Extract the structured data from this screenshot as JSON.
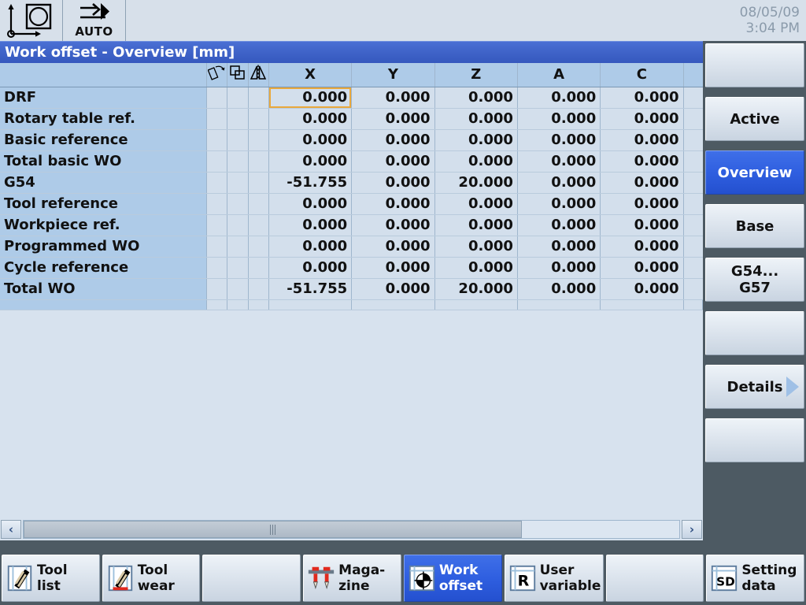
{
  "status_bar": {
    "channel_icon": "coordinate-axes-icon",
    "channel_state_icon": "circle-in-square-icon",
    "mode_icon": "arrow-into-block-icon",
    "mode_label": "AUTO",
    "date": "08/05/09",
    "time": "3:04 PM"
  },
  "window": {
    "title": "Work offset - Overview [mm]"
  },
  "table": {
    "headers": {
      "name": "",
      "rotation_icon": "rotation-icon",
      "scale_icon": "scale-icon",
      "mirror_icon": "mirror-icon",
      "axes": [
        "X",
        "Y",
        "Z",
        "A",
        "C"
      ],
      "tail": ""
    },
    "rows": [
      {
        "name": "DRF",
        "values": [
          "0.000",
          "0.000",
          "0.000",
          "0.000",
          "0.000"
        ]
      },
      {
        "name": "Rotary table ref.",
        "values": [
          "0.000",
          "0.000",
          "0.000",
          "0.000",
          "0.000"
        ]
      },
      {
        "name": "Basic reference",
        "values": [
          "0.000",
          "0.000",
          "0.000",
          "0.000",
          "0.000"
        ]
      },
      {
        "name": "Total basic WO",
        "values": [
          "0.000",
          "0.000",
          "0.000",
          "0.000",
          "0.000"
        ]
      },
      {
        "name": "G54",
        "values": [
          "-51.755",
          "0.000",
          "20.000",
          "0.000",
          "0.000"
        ]
      },
      {
        "name": "Tool reference",
        "values": [
          "0.000",
          "0.000",
          "0.000",
          "0.000",
          "0.000"
        ]
      },
      {
        "name": "Workpiece ref.",
        "values": [
          "0.000",
          "0.000",
          "0.000",
          "0.000",
          "0.000"
        ]
      },
      {
        "name": "Programmed WO",
        "values": [
          "0.000",
          "0.000",
          "0.000",
          "0.000",
          "0.000"
        ]
      },
      {
        "name": "Cycle reference",
        "values": [
          "0.000",
          "0.000",
          "0.000",
          "0.000",
          "0.000"
        ]
      },
      {
        "name": "Total WO",
        "values": [
          "-51.755",
          "0.000",
          "20.000",
          "0.000",
          "0.000"
        ]
      }
    ],
    "selected_cell": {
      "row": 0,
      "col": 0
    }
  },
  "scrollbar": {
    "left_label": "‹",
    "right_label": "›",
    "thumb_percent": 76
  },
  "vertical_softkeys": [
    {
      "label": "",
      "active": false,
      "arrow": false
    },
    {
      "label": "Active",
      "active": false,
      "arrow": false
    },
    {
      "label": "Overview",
      "active": true,
      "arrow": false
    },
    {
      "label": "Base",
      "active": false,
      "arrow": false
    },
    {
      "label": "G54...\nG57",
      "active": false,
      "arrow": false
    },
    {
      "label": "",
      "active": false,
      "arrow": false
    },
    {
      "label": "Details",
      "active": false,
      "arrow": true
    },
    {
      "label": "",
      "active": false,
      "arrow": false
    }
  ],
  "horizontal_softkeys": [
    {
      "label": "Tool\nlist",
      "icon": "tool-list-icon",
      "active": false
    },
    {
      "label": "Tool\nwear",
      "icon": "tool-wear-icon",
      "active": false
    },
    {
      "label": "",
      "icon": "",
      "active": false
    },
    {
      "label": "Maga-\nzine",
      "icon": "magazine-icon",
      "active": false
    },
    {
      "label": "Work\noffset",
      "icon": "work-offset-icon",
      "active": true
    },
    {
      "label": "User\nvariable",
      "icon": "user-variable-icon",
      "active": false
    },
    {
      "label": "",
      "icon": "",
      "active": false
    },
    {
      "label": "Setting\ndata",
      "icon": "setting-data-icon",
      "active": false
    }
  ],
  "colors": {
    "title_blue": "#3f63c8",
    "active_blue": "#2f5fe0",
    "header_blue": "#aecbe8",
    "cell_blue": "#d3dfec",
    "frame_gray": "#4d5a63",
    "selection_orange": "#e9a83c"
  }
}
